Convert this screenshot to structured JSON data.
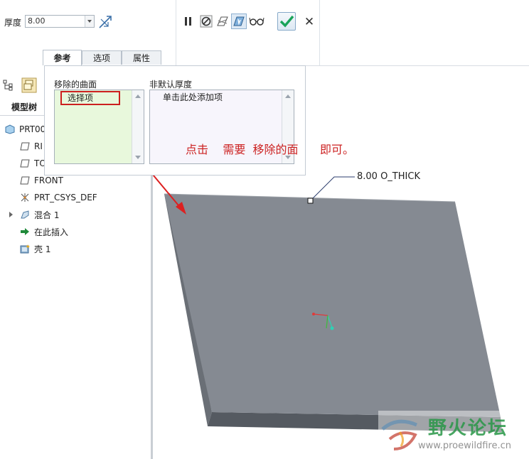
{
  "toolbar": {
    "thickness_label": "厚度",
    "thickness_value": "8.00",
    "icons": [
      "flip-thickness-icon",
      "pause-icon",
      "no-preview-icon",
      "preview-icon",
      "verify-icon",
      "glasses-icon",
      "ok-check-icon",
      "close-x-icon"
    ],
    "close_glyph": "✕"
  },
  "tabs": [
    {
      "label": "参考",
      "active": true
    },
    {
      "label": "选项",
      "active": false
    },
    {
      "label": "属性",
      "active": false
    }
  ],
  "ref_panel": {
    "removed_surfaces_label": "移除的曲面",
    "select_items": "选择项",
    "non_default_label": "非默认厚度",
    "add_item": "单击此处添加项"
  },
  "sidebar": {
    "tab_label": "模型树",
    "items": [
      {
        "label": "PRT00",
        "icon": "part-icon"
      },
      {
        "label": "RI",
        "icon": "datum-plane-icon"
      },
      {
        "label": "TO",
        "icon": "datum-plane-icon"
      },
      {
        "label": "FRONT",
        "icon": "datum-plane-icon"
      },
      {
        "label": "PRT_CSYS_DEF",
        "icon": "csys-icon"
      },
      {
        "label": "混合 1",
        "icon": "blend-icon"
      },
      {
        "label": "在此插入",
        "icon": "insert-arrow-icon"
      },
      {
        "label": "壳 1",
        "icon": "shell-icon"
      }
    ]
  },
  "annotation": {
    "text": "点击    需要  移除的面      即可。",
    "color": "#cc2222"
  },
  "viewport": {
    "dimension_label": "8.00 O_THICK",
    "plate_color": "#858a92"
  },
  "watermark": {
    "title": "野火论坛",
    "url": "www.proewildfire.cn"
  },
  "colors": {
    "accent_green": "#1aa35a",
    "highlight_red": "#cc1f1f",
    "selection_bg": "#e8f8dc",
    "list_bg": "#f7f5fc"
  }
}
